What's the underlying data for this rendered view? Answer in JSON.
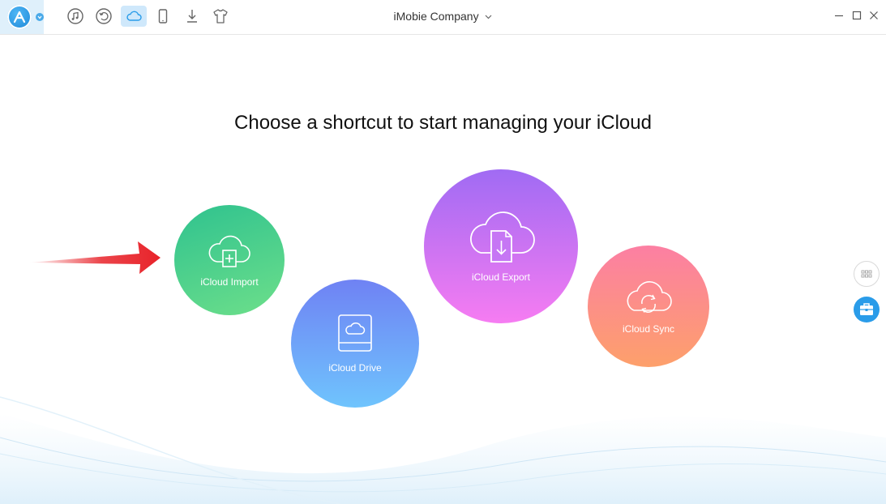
{
  "window": {
    "title": "iMobie Company"
  },
  "toolbar": {
    "items": [
      {
        "icon": "music-icon"
      },
      {
        "icon": "history-icon"
      },
      {
        "icon": "cloud-icon",
        "active": true
      },
      {
        "icon": "phone-icon"
      },
      {
        "icon": "download-icon"
      },
      {
        "icon": "tshirt-icon"
      }
    ]
  },
  "main": {
    "headline": "Choose a shortcut to start managing your iCloud",
    "shortcuts": [
      {
        "label": "iCloud Import",
        "color_from": "#2fc28f",
        "color_to": "#6ddf8a",
        "icon": "cloud-plus-icon"
      },
      {
        "label": "iCloud Drive",
        "color_from": "#6f82f4",
        "color_to": "#6fc4fd",
        "icon": "drive-cloud-icon"
      },
      {
        "label": "iCloud Export",
        "color_from": "#a06bf3",
        "color_to": "#f67cf2",
        "icon": "cloud-download-icon"
      },
      {
        "label": "iCloud Sync",
        "color_from": "#fc7fa3",
        "color_to": "#fda06b",
        "icon": "cloud-sync-icon"
      }
    ]
  },
  "colors": {
    "accent": "#2a9ce9",
    "arrow": "#e8232a"
  }
}
